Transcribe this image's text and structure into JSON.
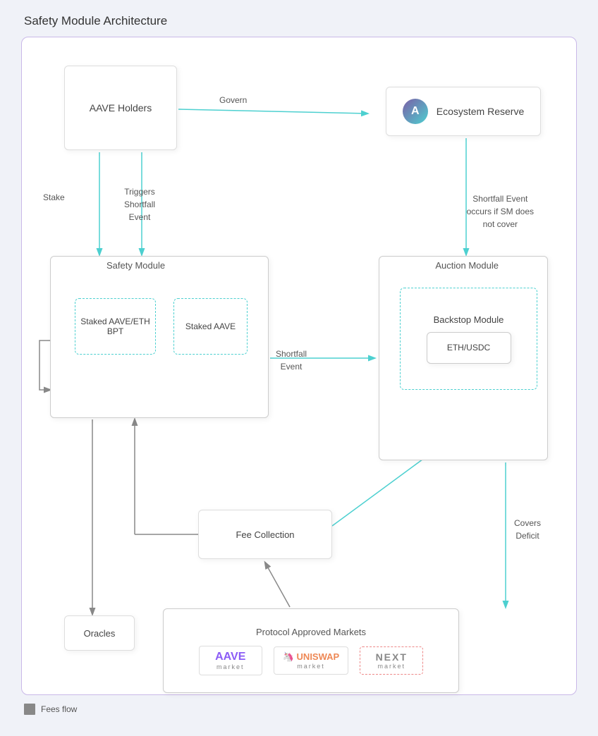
{
  "page": {
    "title": "Safety Module Architecture"
  },
  "boxes": {
    "aave_holders": "AAVE Holders",
    "ecosystem_reserve": "Ecosystem Reserve",
    "safety_module": "Safety Module",
    "staked_eth_bpt": "Staked AAVE/ETH BPT",
    "staked_aave": "Staked AAVE",
    "auction_module": "Auction Module",
    "backstop_module": "Backstop Module",
    "eth_usdc": "ETH/USDC",
    "fee_collection": "Fee Collection",
    "protocol_markets": "Protocol Approved Markets",
    "oracles": "Oracles"
  },
  "markets": [
    {
      "name": "AAVE",
      "sub": "market",
      "style": "solid"
    },
    {
      "name": "UNISWAP",
      "sub": "market",
      "style": "solid"
    },
    {
      "name": "NEXT",
      "sub": "market",
      "style": "dashed"
    }
  ],
  "labels": {
    "govern": "Govern",
    "stake": "Stake",
    "triggers_shortfall": "Triggers\nShortfall\nEvent",
    "shortfall_event_arrow": "Shortfall\nEvent",
    "shortfall_event_occurs": "Shortfall Event\noccurs if SM does\nnot cover",
    "covers_deficit": "Covers\nDeficit"
  },
  "legend": {
    "label": "Fees flow"
  },
  "colors": {
    "teal": "#4dd0d0",
    "purple": "#c9b8e8",
    "gray": "#888888",
    "dark_arrow": "#666666"
  }
}
